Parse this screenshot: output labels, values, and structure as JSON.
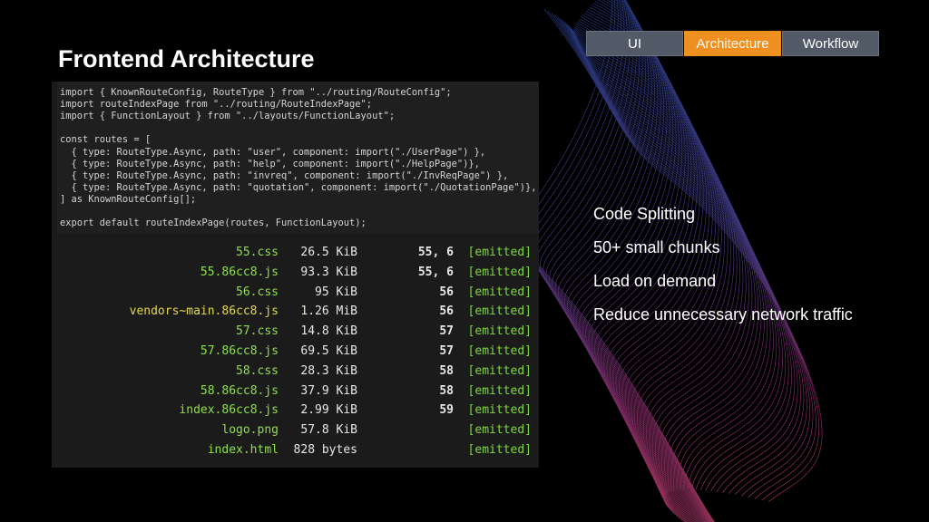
{
  "title": "Frontend Architecture",
  "tabs": [
    {
      "label": "UI",
      "active": false
    },
    {
      "label": "Architecture",
      "active": true
    },
    {
      "label": "Workflow",
      "active": false
    }
  ],
  "colors": {
    "accent": "#ef8f1f",
    "tab_bg": "#525a68",
    "emitted": "#7fd640"
  },
  "code_lines": [
    "import { KnownRouteConfig, RouteType } from \"../routing/RouteConfig\";",
    "import routeIndexPage from \"../routing/RouteIndexPage\";",
    "import { FunctionLayout } from \"../layouts/FunctionLayout\";",
    "",
    "const routes = [",
    "  { type: RouteType.Async, path: \"user\", component: import(\"./UserPage\") },",
    "  { type: RouteType.Async, path: \"help\", component: import(\"./HelpPage\")},",
    "  { type: RouteType.Async, path: \"invreq\", component: import(\"./InvReqPage\") },",
    "  { type: RouteType.Async, path: \"quotation\", component: import(\"./QuotationPage\")},",
    "] as KnownRouteConfig[];",
    "",
    "export default routeIndexPage(routes, FunctionLayout);"
  ],
  "build_rows": [
    {
      "name": "55.css",
      "size": "26.5 KiB",
      "chunk": "55, 6",
      "flag": "[emitted]",
      "color": "green"
    },
    {
      "name": "55.86cc8.js",
      "size": "93.3 KiB",
      "chunk": "55, 6",
      "flag": "[emitted]",
      "color": "green"
    },
    {
      "name": "56.css",
      "size": "95 KiB",
      "chunk": "56",
      "flag": "[emitted]",
      "color": "green"
    },
    {
      "name": "vendors~main.86cc8.js",
      "size": "1.26 MiB",
      "chunk": "56",
      "flag": "[emitted]",
      "color": "yellow"
    },
    {
      "name": "57.css",
      "size": "14.8 KiB",
      "chunk": "57",
      "flag": "[emitted]",
      "color": "green"
    },
    {
      "name": "57.86cc8.js",
      "size": "69.5 KiB",
      "chunk": "57",
      "flag": "[emitted]",
      "color": "green"
    },
    {
      "name": "58.css",
      "size": "28.3 KiB",
      "chunk": "58",
      "flag": "[emitted]",
      "color": "green"
    },
    {
      "name": "58.86cc8.js",
      "size": "37.9 KiB",
      "chunk": "58",
      "flag": "[emitted]",
      "color": "green"
    },
    {
      "name": "index.86cc8.js",
      "size": "2.99 KiB",
      "chunk": "59",
      "flag": "[emitted]",
      "color": "green"
    },
    {
      "name": "logo.png",
      "size": "57.8 KiB",
      "chunk": "",
      "flag": "[emitted]",
      "color": "green"
    },
    {
      "name": "index.html",
      "size": "828 bytes",
      "chunk": "",
      "flag": "[emitted]",
      "color": "green"
    }
  ],
  "bullets": [
    "Code Splitting",
    "50+ small chunks",
    "Load on demand",
    "Reduce unnecessary network traffic"
  ]
}
